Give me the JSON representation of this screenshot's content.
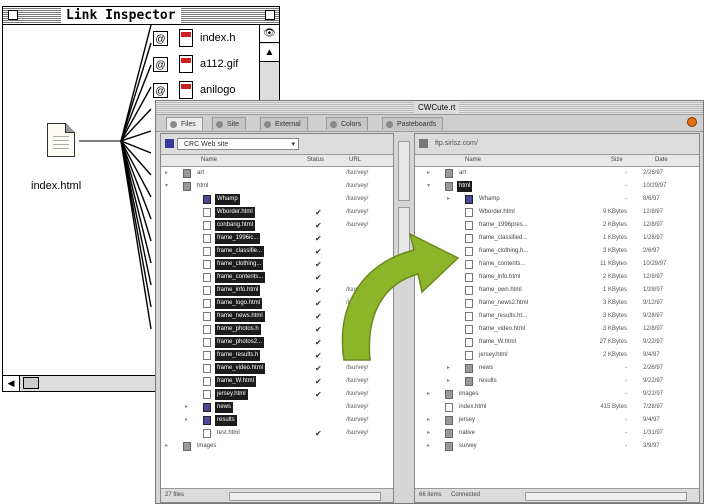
{
  "inspector": {
    "title": "Link Inspector",
    "file_name": "index.html",
    "links": [
      "index.h",
      "a112.gif",
      "anilogo"
    ]
  },
  "cwcute": {
    "title": "CWCute.rt",
    "tabs": [
      "Files",
      "Site",
      "External",
      "Colors",
      "Pasteboards"
    ],
    "local": {
      "site_select": "CRC Web site",
      "columns": [
        "Name",
        "Status",
        "URL"
      ],
      "rows": [
        {
          "name": "art",
          "status": "",
          "url": "/lsurvey/",
          "kind": "folder",
          "indent": 0,
          "tri": "▸"
        },
        {
          "name": "html",
          "status": "",
          "url": "/lsurvey/",
          "kind": "folder",
          "indent": 0,
          "tri": "▾"
        },
        {
          "name": "Whamp",
          "status": "",
          "url": "/lsurvey/",
          "kind": "folder-open",
          "indent": 1,
          "tri": "",
          "hl": true
        },
        {
          "name": "Wborder.html",
          "status": "✔",
          "url": "/lsurvey/",
          "kind": "file",
          "indent": 1,
          "tri": "",
          "hl": true
        },
        {
          "name": "conbang.html",
          "status": "✔",
          "url": "/lsurvey/",
          "kind": "file",
          "indent": 1,
          "tri": "",
          "hl": true
        },
        {
          "name": "frame_1996ic...",
          "status": "✔",
          "url": "",
          "kind": "file",
          "indent": 1,
          "tri": "",
          "hl": true
        },
        {
          "name": "frame_classifie...",
          "status": "✔",
          "url": "",
          "kind": "file",
          "indent": 1,
          "tri": "",
          "hl": true
        },
        {
          "name": "frame_clothing...",
          "status": "✔",
          "url": "",
          "kind": "file",
          "indent": 1,
          "tri": "",
          "hl": true
        },
        {
          "name": "frame_contents...",
          "status": "✔",
          "url": "",
          "kind": "file",
          "indent": 1,
          "tri": "",
          "hl": true
        },
        {
          "name": "frame_info.html",
          "status": "✔",
          "url": "/lsurvey/",
          "kind": "file",
          "indent": 1,
          "tri": "",
          "hl": true
        },
        {
          "name": "frame_logo.html",
          "status": "✔",
          "url": "/lsurvey/",
          "kind": "file",
          "indent": 1,
          "tri": "",
          "hl": true
        },
        {
          "name": "frame_news.html",
          "status": "✔",
          "url": "/lsurvey/",
          "kind": "file",
          "indent": 1,
          "tri": "",
          "hl": true
        },
        {
          "name": "frame_photos.h",
          "status": "✔",
          "url": "/lsurvey/",
          "kind": "file",
          "indent": 1,
          "tri": "",
          "hl": true
        },
        {
          "name": "frame_photos2...",
          "status": "✔",
          "url": "/lsurvey/",
          "kind": "file",
          "indent": 1,
          "tri": "",
          "hl": true
        },
        {
          "name": "frame_results.h",
          "status": "✔",
          "url": "/lsurvey/",
          "kind": "file",
          "indent": 1,
          "tri": "",
          "hl": true
        },
        {
          "name": "frame_video.html",
          "status": "✔",
          "url": "/lsurvey/",
          "kind": "file",
          "indent": 1,
          "tri": "",
          "hl": true
        },
        {
          "name": "frame_W.html",
          "status": "✔",
          "url": "/lsurvey/",
          "kind": "file",
          "indent": 1,
          "tri": "",
          "hl": true
        },
        {
          "name": "jersey.html",
          "status": "✔",
          "url": "/lsurvey/",
          "kind": "file",
          "indent": 1,
          "tri": "",
          "hl": true
        },
        {
          "name": "news",
          "status": "",
          "url": "/lsurvey/",
          "kind": "folder-open",
          "indent": 1,
          "tri": "▸",
          "hl": true
        },
        {
          "name": "results",
          "status": "",
          "url": "/lsurvey/",
          "kind": "folder-open",
          "indent": 1,
          "tri": "▸",
          "hl": true
        },
        {
          "name": "test.html",
          "status": "✔",
          "url": "/lsurvey/",
          "kind": "file",
          "indent": 1,
          "tri": ""
        },
        {
          "name": "images",
          "status": "",
          "url": "",
          "kind": "folder",
          "indent": 0,
          "tri": "▸"
        }
      ],
      "footer": "27 files"
    },
    "remote": {
      "url": "ftp.sirlsz.com/",
      "columns": [
        "Name",
        "Size",
        "Date"
      ],
      "rows": [
        {
          "name": "art",
          "size": "-",
          "date": "2/26/97",
          "kind": "folder",
          "indent": 0,
          "tri": "▸"
        },
        {
          "name": "html",
          "size": "-",
          "date": "10/29/97",
          "kind": "folder",
          "indent": 0,
          "tri": "▾",
          "hl": true
        },
        {
          "name": "Whamp",
          "size": "-",
          "date": "8/6/97",
          "kind": "folder-open",
          "indent": 1,
          "tri": "▸"
        },
        {
          "name": "Wborder.html",
          "size": "9 KBytes",
          "date": "12/8/97",
          "kind": "file",
          "indent": 1,
          "tri": ""
        },
        {
          "name": "frame_1996pres...",
          "size": "2 KBytes",
          "date": "12/8/97",
          "kind": "file",
          "indent": 1,
          "tri": ""
        },
        {
          "name": "frame_classified...",
          "size": "1 KBytes",
          "date": "1/28/97",
          "kind": "file",
          "indent": 1,
          "tri": ""
        },
        {
          "name": "frame_clothing.h...",
          "size": "3 KBytes",
          "date": "2/6/97",
          "kind": "file",
          "indent": 1,
          "tri": ""
        },
        {
          "name": "frame_contents...",
          "size": "11 KBytes",
          "date": "10/29/97",
          "kind": "file",
          "indent": 1,
          "tri": ""
        },
        {
          "name": "frame_info.html",
          "size": "2 KBytes",
          "date": "12/8/97",
          "kind": "file",
          "indent": 1,
          "tri": ""
        },
        {
          "name": "frame_own.html",
          "size": "1 KBytes",
          "date": "1/28/97",
          "kind": "file",
          "indent": 1,
          "tri": ""
        },
        {
          "name": "frame_news2.html",
          "size": "3 KBytes",
          "date": "9/12/97",
          "kind": "file",
          "indent": 1,
          "tri": ""
        },
        {
          "name": "frame_results.ht...",
          "size": "3 KBytes",
          "date": "9/28/97",
          "kind": "file",
          "indent": 1,
          "tri": ""
        },
        {
          "name": "frame_video.html",
          "size": "3 KBytes",
          "date": "12/8/97",
          "kind": "file",
          "indent": 1,
          "tri": ""
        },
        {
          "name": "frame_W.html",
          "size": "27 KBytes",
          "date": "9/22/97",
          "kind": "file",
          "indent": 1,
          "tri": ""
        },
        {
          "name": "jersey.html",
          "size": "2 KBytes",
          "date": "9/4/97",
          "kind": "file",
          "indent": 1,
          "tri": ""
        },
        {
          "name": "news",
          "size": "-",
          "date": "2/26/97",
          "kind": "folder",
          "indent": 1,
          "tri": "▸"
        },
        {
          "name": "results",
          "size": "-",
          "date": "9/22/97",
          "kind": "folder",
          "indent": 1,
          "tri": "▸"
        },
        {
          "name": "images",
          "size": "-",
          "date": "9/22/97",
          "kind": "folder",
          "indent": 0,
          "tri": "▸"
        },
        {
          "name": "index.html",
          "size": "415 Bytes",
          "date": "7/28/97",
          "kind": "file",
          "indent": 0,
          "tri": ""
        },
        {
          "name": "jersey",
          "size": "-",
          "date": "9/4/97",
          "kind": "folder",
          "indent": 0,
          "tri": "▸"
        },
        {
          "name": "native",
          "size": "-",
          "date": "1/31/97",
          "kind": "folder",
          "indent": 0,
          "tri": "▸"
        },
        {
          "name": "survey",
          "size": "-",
          "date": "3/9/97",
          "kind": "folder",
          "indent": 0,
          "tri": "▸"
        }
      ],
      "footer_left": "66 items",
      "footer_status": "Connected"
    }
  },
  "colors": {
    "arrow": "#8db52a",
    "highlight": "#1c1c1c"
  }
}
